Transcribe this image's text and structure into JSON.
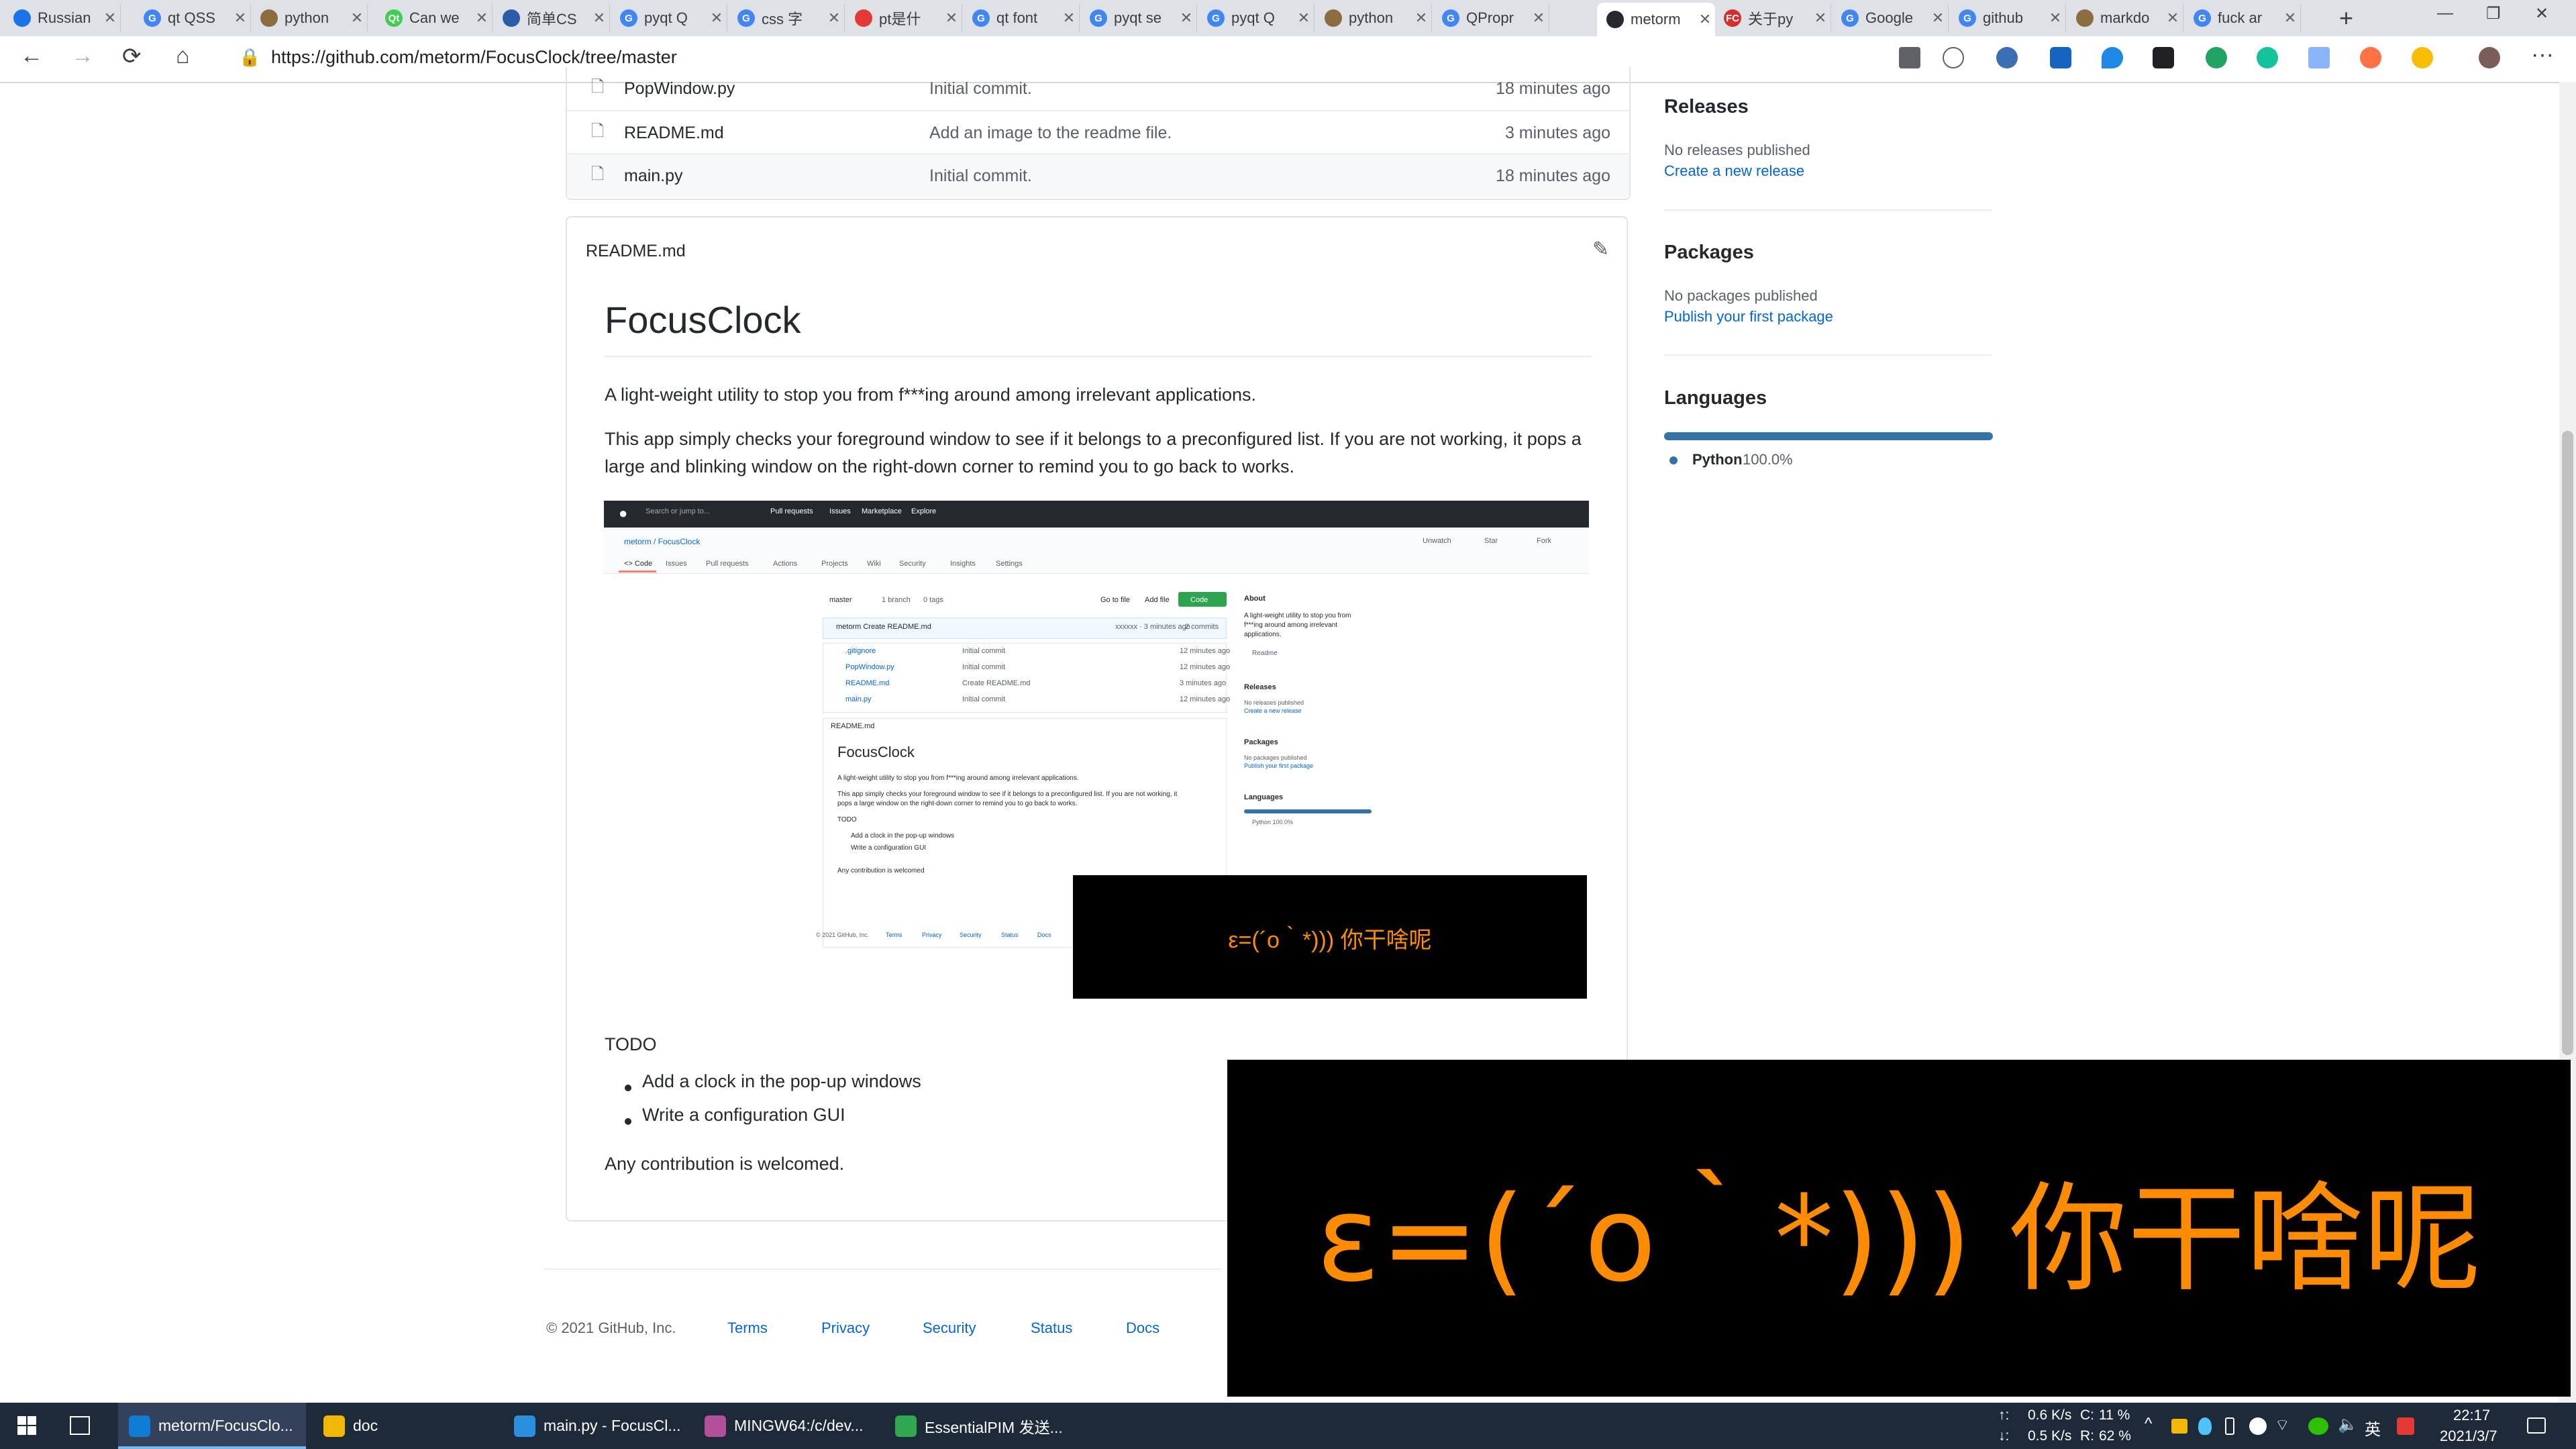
{
  "browser": {
    "tabs": [
      {
        "title": "Russian",
        "color": "#1a73e8",
        "glyph": ""
      },
      {
        "title": "qt QSS",
        "color": "#4285f4",
        "glyph": "G"
      },
      {
        "title": "python",
        "color": "#8c6d3f",
        "glyph": ""
      },
      {
        "title": "Can we",
        "color": "#41cd52",
        "glyph": "Qt"
      },
      {
        "title": "简单CS",
        "color": "#2a5ca8",
        "glyph": ""
      },
      {
        "title": "pyqt Q",
        "color": "#4285f4",
        "glyph": "G"
      },
      {
        "title": "css 字",
        "color": "#4285f4",
        "glyph": "G"
      },
      {
        "title": "pt是什",
        "color": "#e53935",
        "glyph": ""
      },
      {
        "title": "qt font",
        "color": "#4285f4",
        "glyph": "G"
      },
      {
        "title": "pyqt se",
        "color": "#4285f4",
        "glyph": "G"
      },
      {
        "title": "pyqt Q",
        "color": "#4285f4",
        "glyph": "G"
      },
      {
        "title": "python",
        "color": "#8c6d3f",
        "glyph": ""
      },
      {
        "title": "QPropr",
        "color": "#4285f4",
        "glyph": "G"
      },
      {
        "title": "metorm",
        "color": "#24292e",
        "glyph": "",
        "active": true
      },
      {
        "title": "关于py",
        "color": "#d32f2f",
        "glyph": "FC"
      },
      {
        "title": "Google",
        "color": "#4285f4",
        "glyph": "G"
      },
      {
        "title": "github",
        "color": "#4285f4",
        "glyph": "G"
      },
      {
        "title": "markdo",
        "color": "#8c6d3f",
        "glyph": ""
      },
      {
        "title": "fuck ar",
        "color": "#4285f4",
        "glyph": "G"
      }
    ],
    "url": "https://github.com/metorm/FocusClock/tree/master",
    "icons": {
      "back": "←",
      "forward": "→",
      "reload": "⟳",
      "home": "⌂",
      "lock": "🔒",
      "newtab": "+",
      "minimize": "—",
      "restore": "❐",
      "close": "✕",
      "menu": "···"
    }
  },
  "files": [
    {
      "name": "PopWindow.py",
      "message": "Initial commit.",
      "age": "18 minutes ago"
    },
    {
      "name": "README.md",
      "message": "Add an image to the readme file.",
      "age": "3 minutes ago"
    },
    {
      "name": "main.py",
      "message": "Initial commit.",
      "age": "18 minutes ago"
    }
  ],
  "readme": {
    "label": "README.md",
    "title": "FocusClock",
    "p1": "A light-weight utility to stop you from f***ing around among irrelevant applications.",
    "p2": "This app simply checks your foreground window to see if it belongs to a preconfigured list. If you are not working, it pops a large and blinking window on the right-down corner to remind you to go back to works.",
    "todo": "TODO",
    "todo_items": [
      "Add a clock in the pop-up windows",
      "Write a configuration GUI"
    ],
    "closing": "Any contribution is welcomed."
  },
  "embedded": {
    "nav": [
      "Search or jump to...",
      "Pull requests",
      "Issues",
      "Marketplace",
      "Explore"
    ],
    "repo": "metorm / FocusClock",
    "repo_tabs": [
      "<> Code",
      "Issues",
      "Pull requests",
      "Actions",
      "Projects",
      "Wiki",
      "Security",
      "Insights",
      "Settings"
    ],
    "repo_actions": [
      "Unwatch",
      "Star",
      "Fork"
    ],
    "branch": "master",
    "branches": "1 branch",
    "tags": "0 tags",
    "go_to_file": "Go to file",
    "add_file": "Add file",
    "code_btn": "Code",
    "commit": "metorm Create README.md",
    "commit_meta": "xxxxxx · 3 minutes ago",
    "commits": "2 commits",
    "files": [
      {
        "name": ".gitignore",
        "message": "Initial commit",
        "age": "12 minutes ago"
      },
      {
        "name": "PopWindow.py",
        "message": "Initial commit",
        "age": "12 minutes ago"
      },
      {
        "name": "README.md",
        "message": "Create README.md",
        "age": "3 minutes ago"
      },
      {
        "name": "main.py",
        "message": "Initial commit",
        "age": "12 minutes ago"
      }
    ],
    "readme_label": "README.md",
    "title": "FocusClock",
    "p1": "A light-weight utility to stop you from f***ing around among irrelevant applications.",
    "p2a": "This app simply checks your foreground window to see if it belongs to a preconfigured list. If you are not working, it",
    "p2b": "pops a large window on the right-down corner to remind you to go back to works.",
    "todo": "TODO",
    "todo_items": [
      "Add a clock in the pop-up windows",
      "Write a configuration GUI"
    ],
    "closing": "Any contribution is welcomed",
    "about": "About",
    "about_text": [
      "A light-weight utility to stop you from",
      "f***ing around among irrelevant",
      "applications."
    ],
    "readme_link": "Readme",
    "releases": "Releases",
    "releases_text": "No releases published",
    "releases_link": "Create a new release",
    "packages": "Packages",
    "packages_text": "No packages published",
    "packages_link": "Publish your first package",
    "languages": "Languages",
    "lang": "Python 100.0%",
    "footer": [
      "© 2021 GitHub, Inc.",
      "Terms",
      "Privacy",
      "Security",
      "Status",
      "Docs"
    ],
    "popup": "ε=(´ο｀*))) 你干啥呢"
  },
  "sidebar": {
    "releases": "Releases",
    "releases_text": "No releases published",
    "releases_link": "Create a new release",
    "packages": "Packages",
    "packages_text": "No packages published",
    "packages_link": "Publish your first package",
    "languages": "Languages",
    "lang_name": "Python",
    "lang_pct": "100.0%",
    "lang_color": "#3572a5"
  },
  "footer": {
    "copyright": "© 2021 GitHub, Inc.",
    "links": [
      "Terms",
      "Privacy",
      "Security",
      "Status",
      "Docs"
    ]
  },
  "popup": {
    "text": "ε=(´ο｀*))) 你干啥呢",
    "color": "#ff8c00",
    "background": "#000000"
  },
  "taskbar": {
    "start_icon": "windows-icon",
    "items": [
      {
        "label": "metorm/FocusClo...",
        "color": "#0f7dd6",
        "active": true
      },
      {
        "label": "doc",
        "color": "#f2b705"
      },
      {
        "label": "main.py - FocusCl...",
        "color": "#2b8fe0"
      },
      {
        "label": "MINGW64:/c/dev...",
        "color": "#b44f9a"
      },
      {
        "label": "EssentialPIM 发送...",
        "color": "#2fa84f"
      }
    ],
    "net_up": "0.6 K/s",
    "net_down": "0.5 K/s",
    "cpu": "11 %",
    "ram": "62 %",
    "cpu_label": "C:",
    "ram_label": "R:",
    "up_label": "↑:",
    "down_label": "↓:",
    "ime": "英",
    "time": "22:17",
    "date": "2021/3/7"
  }
}
